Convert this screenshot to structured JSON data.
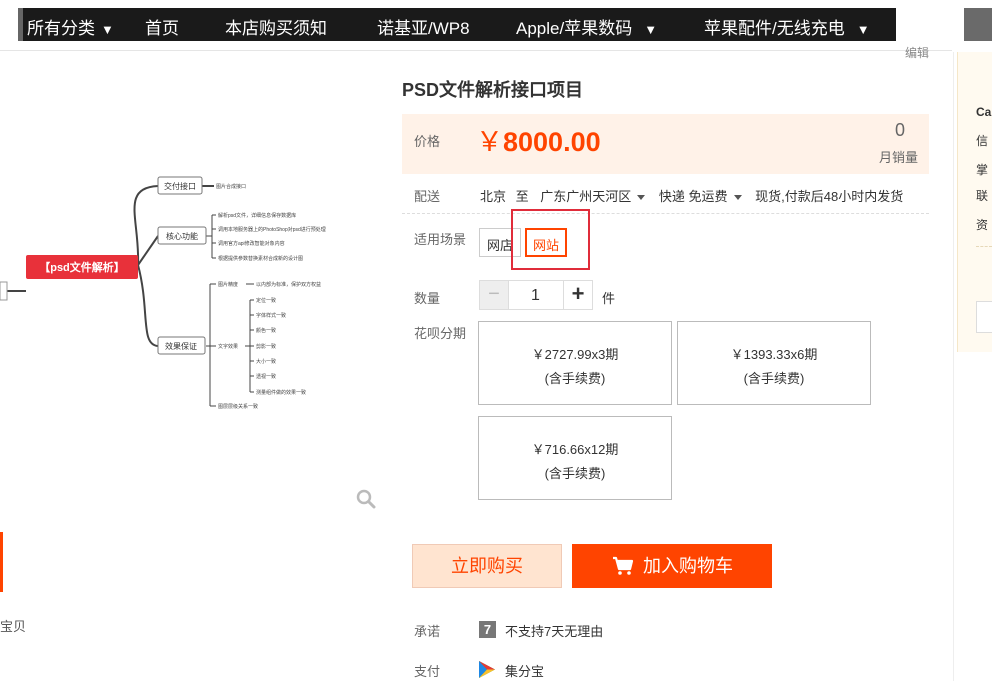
{
  "nav": {
    "items": [
      {
        "label": "所有分类",
        "caret": "▼"
      },
      {
        "label": "首页",
        "caret": ""
      },
      {
        "label": "本店购买须知",
        "caret": ""
      },
      {
        "label": "诺基亚/WP8",
        "caret": ""
      },
      {
        "label": "Apple/苹果数码",
        "caret": "▼"
      },
      {
        "label": "苹果配件/无线充电",
        "caret": "▼"
      }
    ],
    "edit_link": "编辑"
  },
  "right_panel": {
    "lines": [
      "Ca",
      "信",
      "掌",
      "联",
      "资"
    ]
  },
  "mindmap": {
    "root": "【psd文件解析】",
    "branches": [
      {
        "label": "交付接口",
        "leaves": [
          "图片合成接口"
        ]
      },
      {
        "label": "核心功能",
        "leaves": [
          "解析psd文件，详细信息保存数据库",
          "调用本地服务器上的PhotoShop对psd进行预处理",
          "调用官方api修改智能对象内容",
          "根据提供参数替换素材合成新的设计图"
        ]
      },
      {
        "label": "效果保证",
        "leaves": [
          "图片精度",
          "以内部为标准，保护双方权益",
          "文字效果",
          "定位一致",
          "字体样式一致",
          "颜色一致",
          "剪影一致",
          "大小一致",
          "透视一致",
          "测量组件做的效果一致",
          "图层层级关系一致"
        ]
      }
    ]
  },
  "left": {
    "caption": "宝贝"
  },
  "product": {
    "title": "PSD文件解析接口项目",
    "price_label": "价格",
    "currency": "￥",
    "price": "8000.00",
    "sales_count": "0",
    "sales_label": "月销量",
    "delivery_label": "配送",
    "delivery_from": "北京",
    "delivery_to_word": "至",
    "delivery_dest": "广东广州天河区",
    "delivery_method": "快递 免运费",
    "delivery_note": "现货,付款后48小时内发货",
    "scene_label": "适用场景",
    "scene_options": [
      "网店",
      "网站"
    ],
    "qty_label": "数量",
    "qty_minus": "−",
    "qty_value": "1",
    "qty_plus": "+",
    "qty_unit": "件",
    "installment_label": "花呗分期",
    "installments": [
      {
        "line1": "￥2727.99x3期",
        "line2": "(含手续费)"
      },
      {
        "line1": "￥1393.33x6期",
        "line2": "(含手续费)"
      },
      {
        "line1": "￥716.66x12期",
        "line2": "(含手续费)"
      }
    ],
    "buy_now": "立即购买",
    "add_cart": "加入购物车",
    "promise_label": "承诺",
    "promise_icon": "7",
    "promise_text": "不支持7天无理由",
    "pay_label": "支付",
    "pay_text": "集分宝"
  },
  "colors": {
    "accent": "#ff4400",
    "price_bg": "#fff2e8",
    "highlight": "#e02c3a",
    "mindmap_root": "#e8313a"
  }
}
